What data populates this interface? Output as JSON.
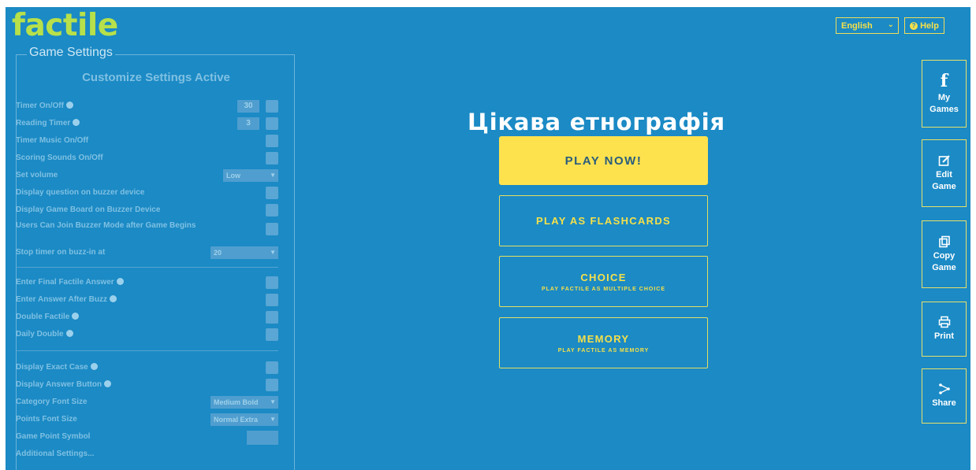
{
  "app": {
    "logo": "factile"
  },
  "topbar": {
    "language": "English",
    "help_label": "Help"
  },
  "sidebar": {
    "items": [
      {
        "icon": "facebook-icon",
        "label_line1": "My",
        "label_line2": "Games"
      },
      {
        "icon": "edit-icon",
        "label_line1": "Edit",
        "label_line2": "Game"
      },
      {
        "icon": "copy-icon",
        "label_line1": "Copy",
        "label_line2": "Game"
      },
      {
        "icon": "print-icon",
        "label_line1": "Print",
        "label_line2": ""
      },
      {
        "icon": "share-icon",
        "label_line1": "Share",
        "label_line2": ""
      }
    ]
  },
  "settings": {
    "legend": "Game Settings",
    "heading": "Customize Settings Active",
    "rows": [
      {
        "label": "Timer On/Off",
        "info": true,
        "control": "number",
        "value": "30"
      },
      {
        "label": "Reading Timer",
        "info": true,
        "control": "number",
        "value": "3"
      },
      {
        "label": "Timer Music On/Off",
        "info": false,
        "control": "checkbox"
      },
      {
        "label": "Scoring Sounds On/Off",
        "info": false,
        "control": "checkbox"
      },
      {
        "label": "Set volume",
        "info": false,
        "control": "select",
        "value": "Low"
      },
      {
        "label": "Display question on buzzer device",
        "info": false,
        "control": "checkbox"
      },
      {
        "label": "Display Game Board on Buzzer Device",
        "info": false,
        "control": "checkbox"
      },
      {
        "label": "Users Can Join Buzzer Mode after Game Begins",
        "info": false,
        "control": "checkbox"
      },
      {
        "label": "Stop timer on buzz-in at",
        "info": false,
        "control": "select",
        "value": "20"
      },
      {
        "label": "Enter Final Factile Answer",
        "info": true,
        "control": "checkbox"
      },
      {
        "label": "Enter Answer After Buzz",
        "info": true,
        "control": "checkbox"
      },
      {
        "label": "Double Factile",
        "info": true,
        "control": "checkbox"
      },
      {
        "label": "Daily Double",
        "info": true,
        "control": "checkbox"
      },
      {
        "label": "Display Exact Case",
        "info": true,
        "control": "checkbox"
      },
      {
        "label": "Display Answer Button",
        "info": true,
        "control": "checkbox"
      },
      {
        "label": "Category Font Size",
        "info": false,
        "control": "select",
        "value": "Medium Bold"
      },
      {
        "label": "Points Font Size",
        "info": false,
        "control": "select",
        "value": "Normal Extra"
      },
      {
        "label": "Game Point Symbol",
        "info": false,
        "control": "text",
        "value": ""
      },
      {
        "label": "Additional Settings...",
        "info": false,
        "control": "none"
      }
    ]
  },
  "game": {
    "title": "Цікава етнографія",
    "play_now": "PLAY NOW!",
    "flashcards": "PLAY AS FLASHCARDS",
    "choice": "CHOICE",
    "choice_sub": "PLAY FACTILE AS MULTIPLE CHOICE",
    "memory": "MEMORY",
    "memory_sub": "PLAY FACTILE AS MEMORY"
  },
  "colors": {
    "background": "#1b8ac5",
    "accent_yellow": "#fde24e",
    "logo_green": "#b7e04a"
  }
}
